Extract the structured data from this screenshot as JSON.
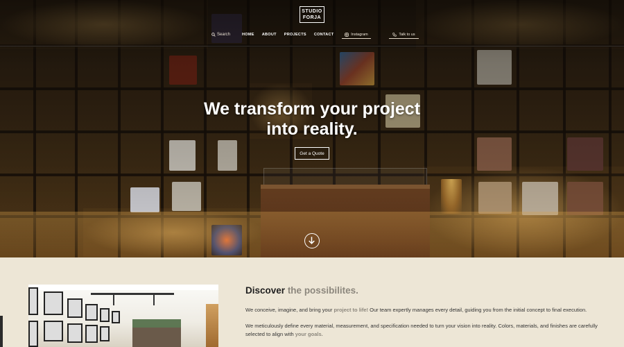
{
  "brand": {
    "logo_line1": "STUDIO",
    "logo_line2": "FORJA"
  },
  "nav": {
    "search_label": "Search",
    "links": [
      "HOME",
      "ABOUT",
      "PROJECTS",
      "CONTACT"
    ],
    "instagram_label": "Instagram",
    "talk_label": "Talk to us"
  },
  "hero": {
    "headline_line1": "We transform your project",
    "headline_line2": "into reality.",
    "cta_label": "Get a Quote"
  },
  "section": {
    "title_main": "Discover",
    "title_accent": "the possibilites.",
    "p1_before": "We conceive, imagine, and bring your ",
    "p1_highlight": "project to life!",
    "p1_after": " Our team expertly manages every detail, guiding you from the initial concept to final execution.",
    "p2_before": "We meticulously define every material, measurement, and specification needed to turn your vision into reality. Colors, materials, and finishes are carefully selected to align with ",
    "p2_highlight": "your goals."
  },
  "colors": {
    "accent": "#8c877d",
    "background": "#ede6d6",
    "hero_dark": "#2a1f12"
  }
}
